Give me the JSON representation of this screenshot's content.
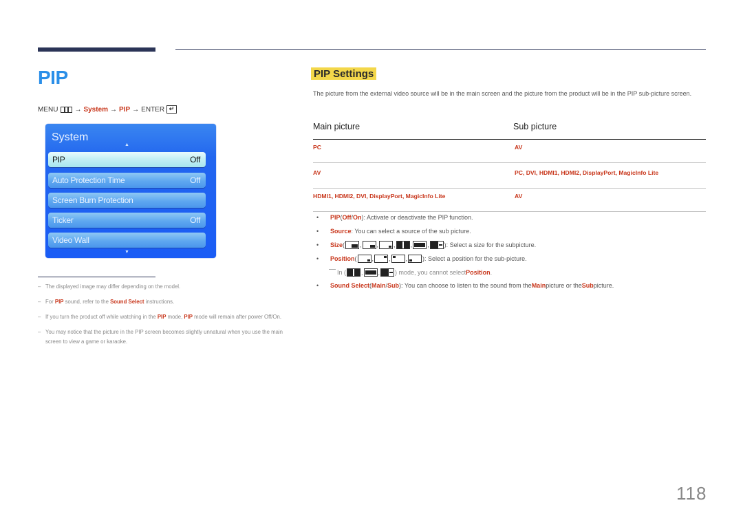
{
  "header": {
    "page_title": "PIP",
    "menu_path": {
      "menu_label": "MENU",
      "arrow": "→",
      "system": "System",
      "pip": "PIP",
      "enter_label": "ENTER",
      "enter_icon": "↵"
    }
  },
  "osd": {
    "title": "System",
    "up_arrow": "▲",
    "down_arrow": "▼",
    "items": [
      {
        "label": "PIP",
        "value": "Off",
        "selected": true
      },
      {
        "label": "Auto Protection Time",
        "value": "Off",
        "selected": false
      },
      {
        "label": "Screen Burn Protection",
        "value": "",
        "selected": false
      },
      {
        "label": "Ticker",
        "value": "Off",
        "selected": false
      },
      {
        "label": "Video Wall",
        "value": "",
        "selected": false
      }
    ]
  },
  "notes": {
    "dash": "–",
    "n1": "The displayed image may differ depending on the model.",
    "n2_a": "For ",
    "n2_b": "PIP",
    "n2_c": " sound, refer to the ",
    "n2_d": "Sound Select",
    "n2_e": " instructions.",
    "n3_a": "If you turn the product off while watching in the ",
    "n3_b": "PIP",
    "n3_c": " mode, ",
    "n3_d": "PIP",
    "n3_e": " mode will remain after power Off/On.",
    "n4": "You may notice that the picture in the PIP screen becomes slightly unnatural when you use the main screen to view a game or karaoke."
  },
  "section": {
    "title": "PIP Settings",
    "intro": "The picture from the external video source will be in the main screen and the picture from the product will be in the PIP sub-picture screen."
  },
  "table": {
    "headers": [
      "Main picture",
      "Sub picture"
    ],
    "rows": [
      {
        "main": "PC",
        "sub": "AV"
      },
      {
        "main": "AV",
        "sub": "PC, DVI, HDMI1, HDMI2, DisplayPort, MagicInfo Lite"
      },
      {
        "main": "HDMI1, HDMI2, DVI, DisplayPort, MagicInfo Lite",
        "sub": "AV"
      }
    ]
  },
  "bullets": {
    "dot": "•",
    "pip": {
      "label": "PIP",
      "open": " (",
      "off": "Off",
      "slash": " / ",
      "on": "On",
      "rest": "): Activate or deactivate the PIP function."
    },
    "source": {
      "label": "Source",
      "rest": ": You can select a source of the sub picture."
    },
    "size": {
      "label": "Size",
      "open": " (",
      "rest": "): Select a size for the subpicture.",
      "icons": [
        "size-large-icon",
        "size-medium-icon",
        "size-small-icon",
        "size-side-by-side-large-icon",
        "size-side-by-side-small-icon",
        "size-side-by-side-split-icon"
      ]
    },
    "position": {
      "label": "Position",
      "open": " (",
      "rest": "): Select a position for the sub-picture.",
      "icons": [
        "position-bottom-right-icon",
        "position-top-right-icon",
        "position-top-left-icon",
        "position-bottom-left-icon"
      ]
    },
    "position_note": {
      "a": "In (",
      "b": ") mode, you cannot select ",
      "c": "Position",
      "d": "."
    },
    "sound": {
      "label": "Sound Select",
      "open": " (",
      "main": "Main",
      "slash": " / ",
      "sub": "Sub",
      "rest_a": "): You can choose to listen to the sound from the ",
      "main2": "Main",
      "rest_b": " picture or the ",
      "sub2": "Sub",
      "rest_c": " picture."
    }
  },
  "colors": {
    "accent_red": "#c8361b",
    "title_blue": "#2b8fe8",
    "highlight_yellow": "#f3d74a",
    "osd_blue": "#1a5cf5"
  },
  "footer": {
    "page_number": "118"
  }
}
